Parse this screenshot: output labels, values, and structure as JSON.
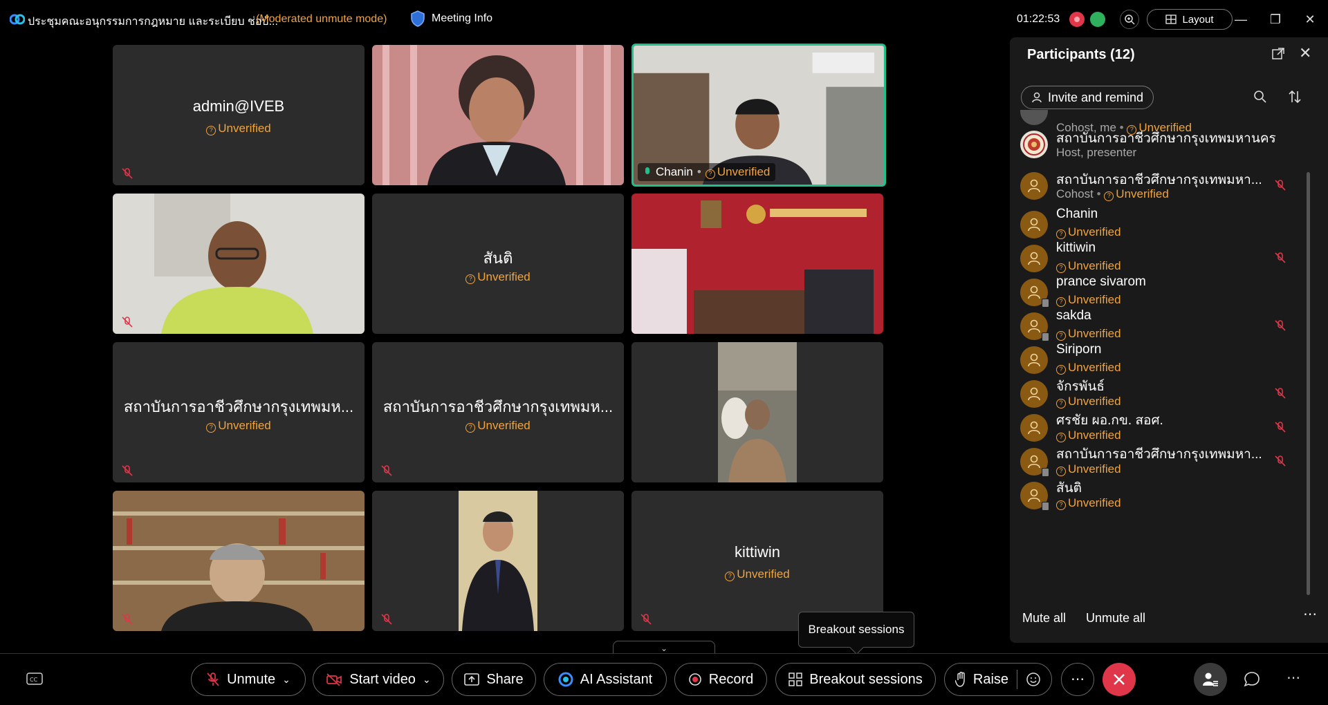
{
  "titlebar": {
    "title": "ประชุมคณะอนุกรรมการกฎหมาย และระเบียบ ช่อบั...",
    "mode": "(Moderated unmute mode)",
    "meeting_info": "Meeting Info",
    "timer": "01:22:53",
    "layout": "Layout"
  },
  "tiles": {
    "t1": {
      "name": "admin@IVEB",
      "status": "Unverified"
    },
    "t3": {
      "name": "Chanin",
      "status": "Unverified"
    },
    "t5": {
      "name": "สันติ",
      "status": "Unverified"
    },
    "t7": {
      "name": "สถาบันการอาชีวศึกษากรุงเทพมห...",
      "status": "Unverified"
    },
    "t8": {
      "name": "สถาบันการอาชีวศึกษากรุงเทพมห...",
      "status": "Unverified"
    },
    "t12": {
      "name": "kittiwin",
      "status": "Unverified"
    }
  },
  "panel": {
    "title": "Participants (12)",
    "invite": "Invite and remind",
    "participants": [
      {
        "name": "",
        "sub": "Cohost, me",
        "status": "Unverified"
      },
      {
        "name": "สถาบันการอาชีวศึกษากรุงเทพมหานคร",
        "sub": "Host, presenter",
        "status": ""
      },
      {
        "name": "สถาบันการอาชีวศึกษากรุงเทพมหา...",
        "sub": "Cohost",
        "status": "Unverified"
      },
      {
        "name": "Chanin",
        "sub": "",
        "status": "Unverified"
      },
      {
        "name": "kittiwin",
        "sub": "",
        "status": "Unverified"
      },
      {
        "name": "prance sivarom",
        "sub": "",
        "status": "Unverified"
      },
      {
        "name": "sakda",
        "sub": "",
        "status": "Unverified"
      },
      {
        "name": "Siriporn",
        "sub": "",
        "status": "Unverified"
      },
      {
        "name": "จักรพันธ์",
        "sub": "",
        "status": "Unverified"
      },
      {
        "name": "ศรชัย ผอ.กข. สอศ.",
        "sub": "",
        "status": "Unverified"
      },
      {
        "name": "สถาบันการอาชีวศึกษากรุงเทพมหา...",
        "sub": "",
        "status": "Unverified"
      },
      {
        "name": "สันติ",
        "sub": "",
        "status": "Unverified"
      }
    ],
    "mute_all": "Mute all",
    "unmute_all": "Unmute all"
  },
  "tooltip": "Breakout sessions",
  "controls": {
    "unmute": "Unmute",
    "start_video": "Start video",
    "share": "Share",
    "ai_assistant": "AI Assistant",
    "record": "Record",
    "breakout": "Breakout sessions",
    "raise": "Raise"
  },
  "colors": {
    "accent_orange": "#f2a33a",
    "end_red": "#e0364a",
    "active_border": "#1ec08b"
  }
}
